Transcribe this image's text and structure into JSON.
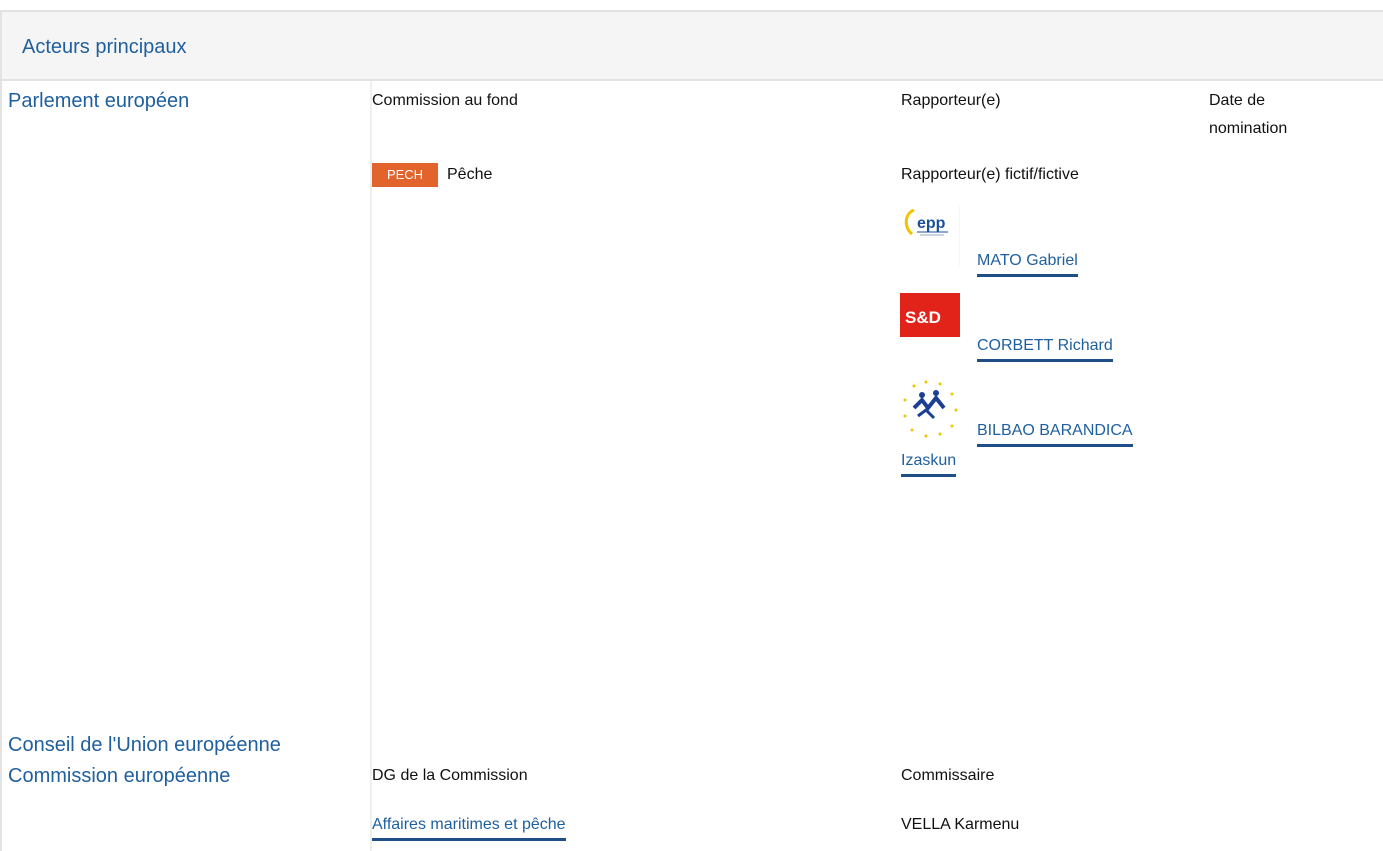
{
  "header": {
    "title": "Acteurs principaux"
  },
  "sections": {
    "parlement": "Parlement européen",
    "conseil": "Conseil de l'Union européenne",
    "commission": "Commission européenne"
  },
  "parlement": {
    "col_committee": "Commission au fond",
    "col_rapporteur": "Rapporteur(e)",
    "col_date_line1": "Date de",
    "col_date_line2": "nomination",
    "committee_tag": "PECH",
    "committee_name": "Pêche",
    "shadow_label": "Rapporteur(e) fictif/fictive",
    "shadow_rapporteurs": [
      {
        "name": "MATO Gabriel",
        "group_logo": "epp-logo",
        "logo_text": "epp"
      },
      {
        "name": "CORBETT Richard",
        "group_logo": "sd-logo",
        "logo_text": "S&D"
      },
      {
        "name_line1": "BILBAO BARANDICA",
        "name_line2": "Izaskun",
        "group_logo": "alde-logo"
      }
    ]
  },
  "commission": {
    "col_dg": "DG de la Commission",
    "col_commissioner": "Commissaire",
    "dg_value": "Affaires maritimes et pêche",
    "commissioner_value": "VELLA Karmenu"
  },
  "colors": {
    "link": "#1f5f9e",
    "tag": "#e2632b",
    "header_bg": "#f5f5f5"
  }
}
